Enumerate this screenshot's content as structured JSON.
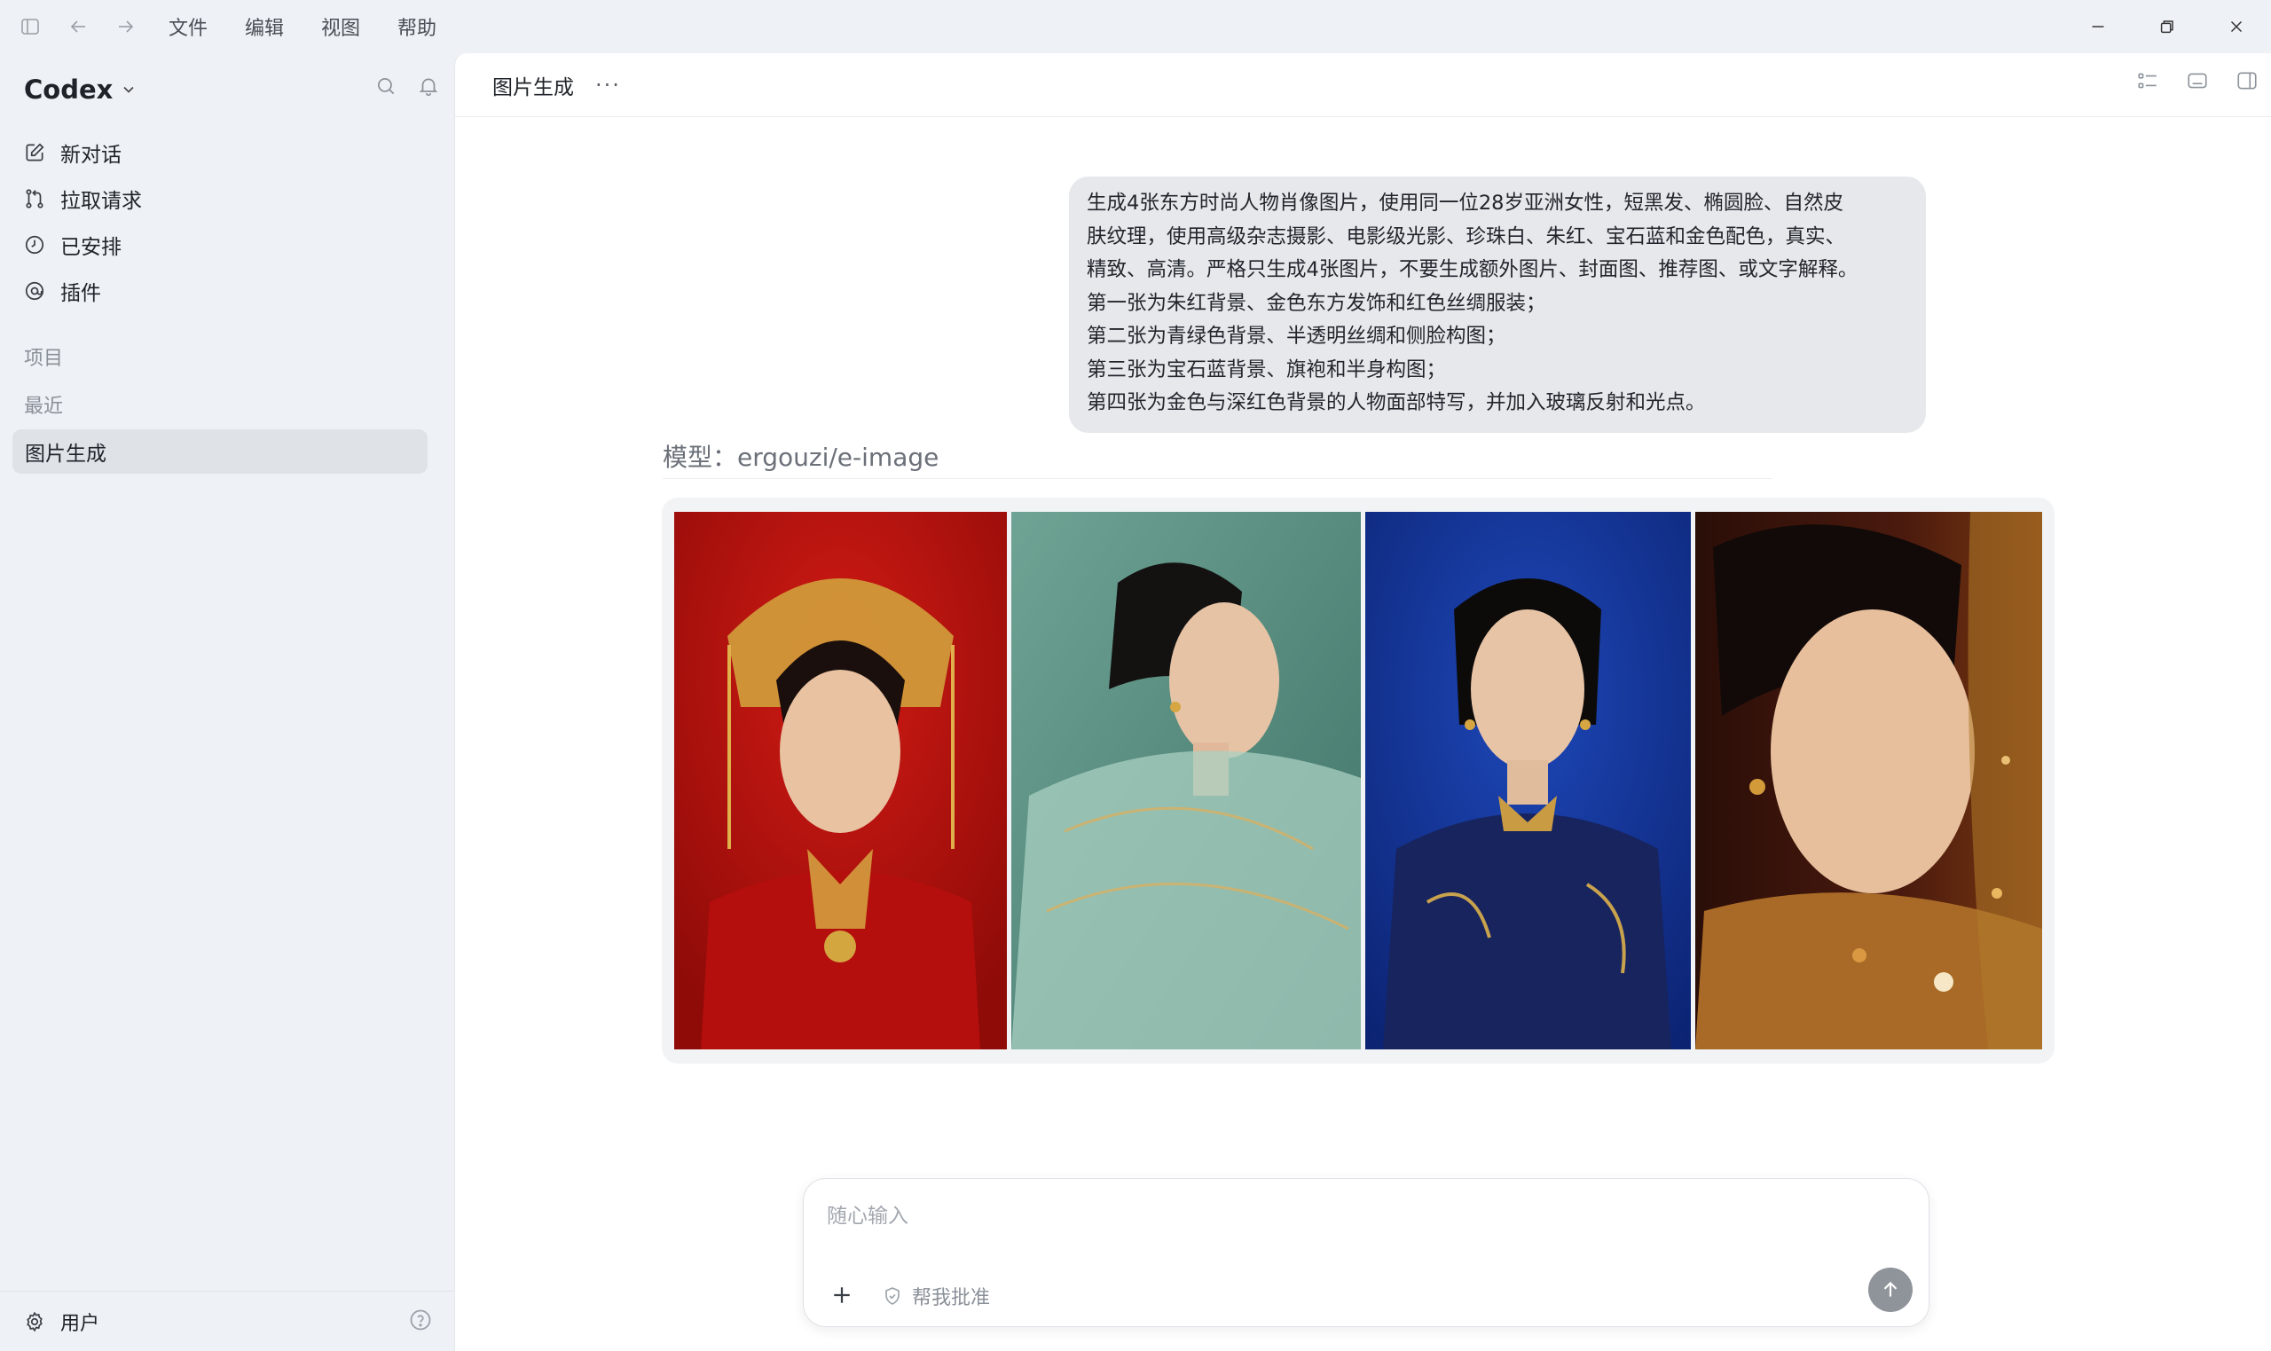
{
  "menu": {
    "file": "文件",
    "edit": "编辑",
    "view": "视图",
    "help": "帮助"
  },
  "sidebar": {
    "brand": "Codex",
    "items": [
      {
        "label": "新对话",
        "icon": "edit-icon"
      },
      {
        "label": "拉取请求",
        "icon": "pull-request-icon"
      },
      {
        "label": "已安排",
        "icon": "clock-icon"
      },
      {
        "label": "插件",
        "icon": "plugin-icon"
      }
    ],
    "projects_label": "项目",
    "recent_label": "最近",
    "recent_items": [
      {
        "label": "图片生成",
        "active": true
      }
    ],
    "user_label": "用户"
  },
  "main": {
    "title": "图片生成",
    "more": "···",
    "message_lines": [
      "生成4张东方时尚人物肖像图片，使用同一位28岁亚洲女性，短黑发、椭圆脸、自然皮",
      "肤纹理，使用高级杂志摄影、电影级光影、珍珠白、朱红、宝石蓝和金色配色，真实、",
      "精致、高清。严格只生成4张图片，不要生成额外图片、封面图、推荐图、或文字解释。",
      "第一张为朱红背景、金色东方发饰和红色丝绸服装；",
      "第二张为青绿色背景、半透明丝绸和侧脸构图；",
      "第三张为宝石蓝背景、旗袍和半身构图；",
      "第四张为金色与深红色背景的人物面部特写，并加入玻璃反射和光点。"
    ],
    "model_line": "模型：ergouzi/e-image",
    "images": [
      {
        "alt": "朱红背景肖像",
        "bg": "#b3110f"
      },
      {
        "alt": "青绿色背景肖像",
        "bg": "#5f9486"
      },
      {
        "alt": "宝石蓝背景肖像",
        "bg": "#10308a"
      },
      {
        "alt": "金色与深红色背景肖像",
        "bg": "#3a140c"
      }
    ]
  },
  "composer": {
    "placeholder": "随心输入",
    "value": "",
    "approve_label": "帮我批准"
  },
  "colors": {
    "accent_send": "#8f949b",
    "sidebar_bg": "#eef1f5",
    "active_item": "#dfe3e8"
  }
}
